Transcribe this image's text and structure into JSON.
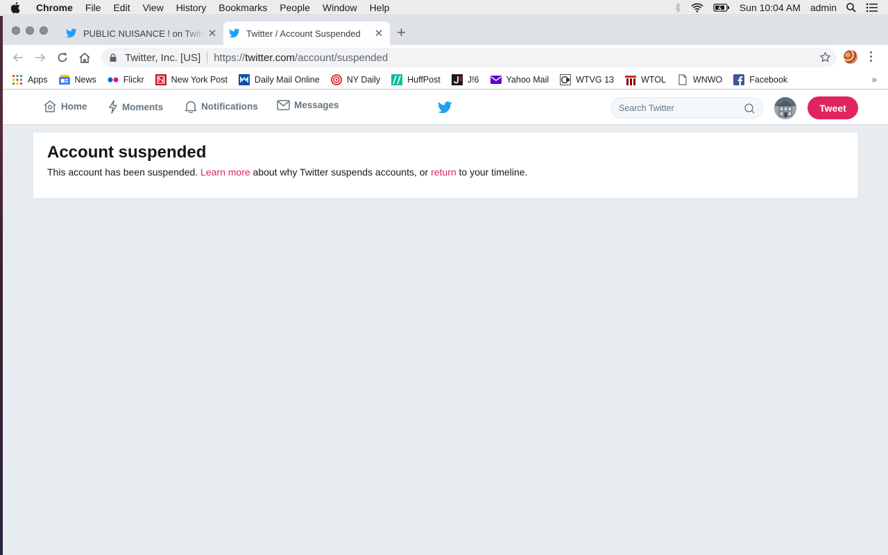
{
  "menubar": {
    "items": [
      "Chrome",
      "File",
      "Edit",
      "View",
      "History",
      "Bookmarks",
      "People",
      "Window",
      "Help"
    ],
    "clock": "Sun 10:04 AM",
    "user": "admin"
  },
  "tabs": [
    {
      "title": "PUBLIC NUISANCE ! on Twitter",
      "icon": "twitter-bird-icon",
      "active": false
    },
    {
      "title": "Twitter / Account Suspended",
      "icon": "twitter-bird-icon",
      "active": true
    }
  ],
  "toolbar": {
    "site_org": "Twitter, Inc. [US]",
    "url_prefix": "https://",
    "url_host": "twitter.com",
    "url_path": "/account/suspended"
  },
  "bookmarks": [
    {
      "label": "Apps",
      "icon": "apps-grid-icon"
    },
    {
      "label": "News",
      "icon": "google-news-icon"
    },
    {
      "label": "Flickr",
      "icon": "flickr-icon"
    },
    {
      "label": "New York Post",
      "icon": "nypost-icon"
    },
    {
      "label": "Daily Mail Online",
      "icon": "dailymail-icon"
    },
    {
      "label": "NY Daily",
      "icon": "nydaily-icon"
    },
    {
      "label": "HuffPost",
      "icon": "huffpost-icon"
    },
    {
      "label": "J!6",
      "icon": "j6-icon"
    },
    {
      "label": "Yahoo Mail",
      "icon": "yahoo-mail-icon"
    },
    {
      "label": "WTVG 13",
      "icon": "wtvg-icon"
    },
    {
      "label": "WTOL",
      "icon": "wtol-icon"
    },
    {
      "label": "WNWO",
      "icon": "page-icon"
    },
    {
      "label": "Facebook",
      "icon": "facebook-icon"
    }
  ],
  "twitter_nav": {
    "home": "Home",
    "moments": "Moments",
    "notifications": "Notifications",
    "messages": "Messages",
    "search_placeholder": "Search Twitter",
    "tweet_button": "Tweet"
  },
  "suspended": {
    "title": "Account suspended",
    "text_before": "This account has been suspended. ",
    "learn_more": "Learn more",
    "text_middle": " about why Twitter suspends accounts, or ",
    "return_link": "return",
    "text_after": " to your timeline."
  },
  "colors": {
    "twitter_blue": "#1da1f2",
    "tweet_button": "#e0245e",
    "link": "#e0245e",
    "page_bg": "#e6ecf0"
  }
}
